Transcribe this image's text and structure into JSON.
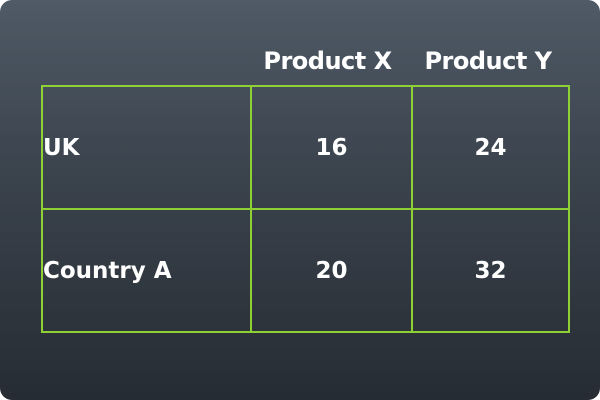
{
  "table": {
    "columns": [
      "",
      "Product X",
      "Product Y"
    ],
    "rows": [
      {
        "label": "UK",
        "product_x": "16",
        "product_y": "24"
      },
      {
        "label": "Country A",
        "product_x": "20",
        "product_y": "32"
      }
    ]
  },
  "colors": {
    "grid_line": "#8fd135",
    "background_top": "#4f5a66",
    "background_bottom": "#262c33",
    "text": "#ffffff"
  }
}
